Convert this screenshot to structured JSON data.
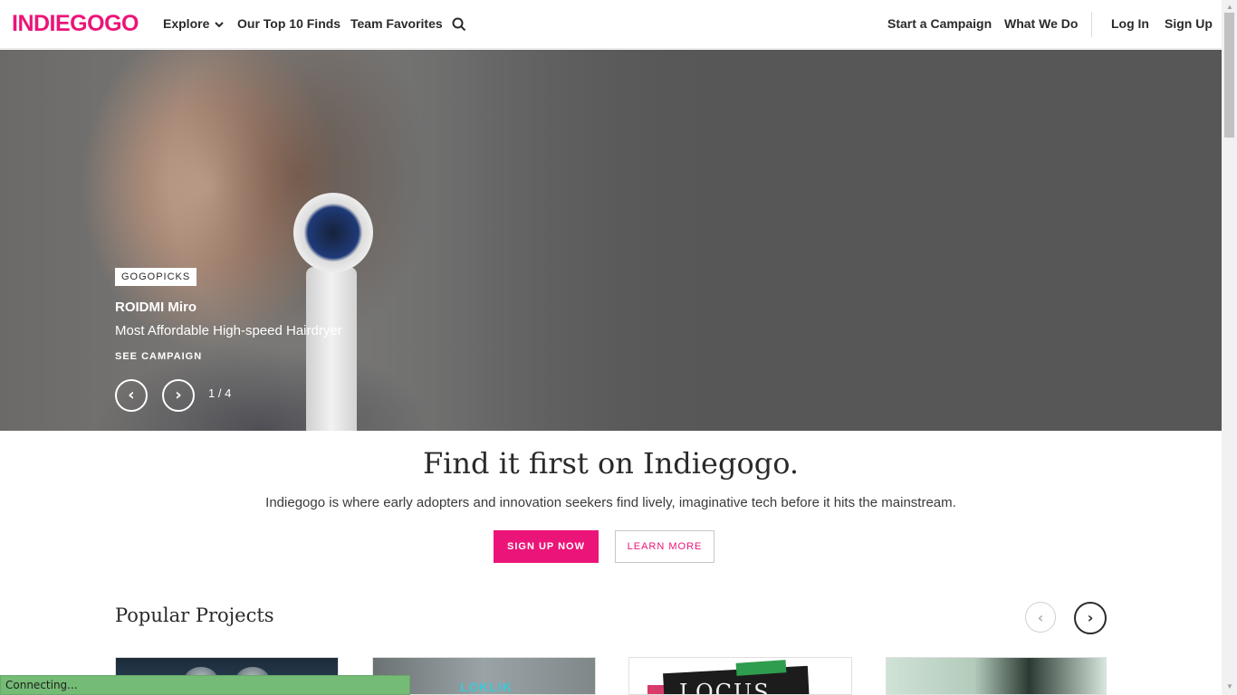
{
  "header": {
    "logo": "INDIEGOGO",
    "nav_left": [
      "Explore",
      "Our Top 10 Finds",
      "Team Favorites"
    ],
    "explore_chevron": "⌄",
    "nav_right": [
      "Start a Campaign",
      "What We Do",
      "Log In",
      "Sign Up"
    ],
    "search_icon": "search-icon"
  },
  "hero": {
    "tag": "GOGOPICKS",
    "title": "ROIDMI Miro",
    "subtitle": "Most Affordable High-speed Hairdryer",
    "cta": "SEE CAMPAIGN",
    "prev": "‹",
    "next": "›",
    "counter": "1 / 4"
  },
  "intro": {
    "title": "Find it first on Indiegogo.",
    "description": "Indiegogo is where early adopters and innovation seekers find lively, imaginative tech before it hits the mainstream.",
    "primary_button": "SIGN UP NOW",
    "secondary_button": "LEARN MORE"
  },
  "popular": {
    "title": "Popular Projects",
    "prev": "‹",
    "next": "›",
    "cards": [
      {
        "brand": ""
      },
      {
        "brand": "LOKLIK"
      },
      {
        "brand": "LOCUS"
      },
      {
        "brand": ""
      }
    ]
  },
  "status_bar": "Connecting...",
  "colors": {
    "brand_pink": "#eb1478",
    "hero_bg": "#575757",
    "status_green": "#74bb75"
  }
}
